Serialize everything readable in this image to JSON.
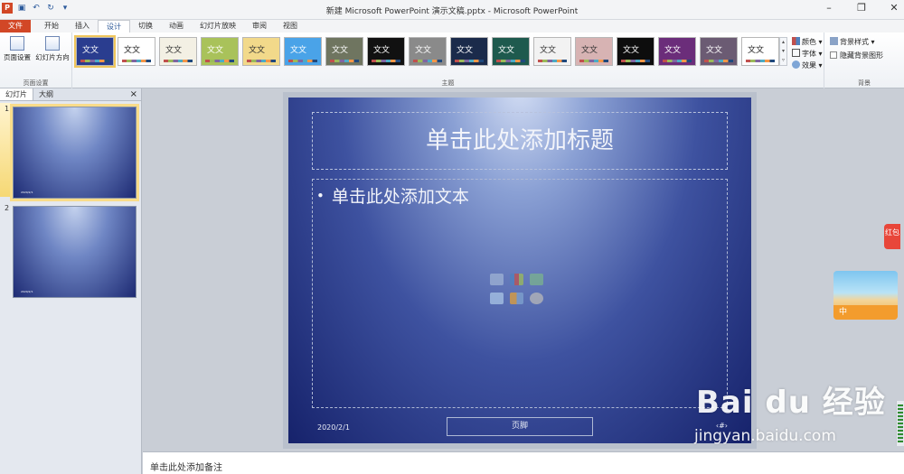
{
  "window": {
    "title": "新建 Microsoft PowerPoint 演示文稿.pptx - Microsoft PowerPoint",
    "app_logo": "P"
  },
  "ribbon_tabs": [
    "文件",
    "开始",
    "插入",
    "设计",
    "切换",
    "动画",
    "幻灯片放映",
    "审阅",
    "视图"
  ],
  "active_tab": "设计",
  "groups": {
    "page_setup": {
      "label": "页面设置",
      "btn_setup": "页面设置",
      "btn_orientation": "幻灯片方向"
    },
    "themes": {
      "label": "主题",
      "items": [
        {
          "text": "文文",
          "bg": "#2a3d8f",
          "fg": "#ffffff"
        },
        {
          "text": "文文",
          "bg": "#ffffff",
          "fg": "#222222"
        },
        {
          "text": "文文",
          "bg": "#f3f0e4",
          "fg": "#333333"
        },
        {
          "text": "文文",
          "bg": "#a9c25a",
          "fg": "#ffffff"
        },
        {
          "text": "文文",
          "bg": "#f2d98a",
          "fg": "#333333"
        },
        {
          "text": "文文",
          "bg": "#4aa3e8",
          "fg": "#ffffff"
        },
        {
          "text": "文文",
          "bg": "#6f7560",
          "fg": "#ffffff"
        },
        {
          "text": "文文",
          "bg": "#111111",
          "fg": "#ffffff"
        },
        {
          "text": "文文",
          "bg": "#8a8a8a",
          "fg": "#ffffff"
        },
        {
          "text": "文文",
          "bg": "#1b2b4b",
          "fg": "#ffffff"
        },
        {
          "text": "文文",
          "bg": "#1e5a4e",
          "fg": "#ffffff"
        },
        {
          "text": "文文",
          "bg": "#f2f2f2",
          "fg": "#333333"
        },
        {
          "text": "文文",
          "bg": "#d7b3b3",
          "fg": "#333333"
        },
        {
          "text": "文文",
          "bg": "#0d0d0d",
          "fg": "#ffffff"
        },
        {
          "text": "文文",
          "bg": "#6b2d7a",
          "fg": "#ffffff"
        },
        {
          "text": "文文",
          "bg": "#6b5b73",
          "fg": "#ffffff"
        },
        {
          "text": "文文",
          "bg": "#ffffff",
          "fg": "#222222"
        }
      ]
    },
    "theme_options": {
      "colors": "颜色",
      "fonts": "字体",
      "effects": "效果"
    },
    "background": {
      "label": "背景",
      "styles": "背景样式",
      "hide_graphics": "隐藏背景图形"
    }
  },
  "panel": {
    "tab_slides": "幻灯片",
    "tab_outline": "大纲",
    "close": "×",
    "slide_numbers": [
      "1",
      "2"
    ]
  },
  "slide": {
    "title_placeholder": "单击此处添加标题",
    "body_placeholder": "单击此处添加文本",
    "date": "2020/2/1",
    "footer": "页脚",
    "number": "‹#›"
  },
  "notes": {
    "placeholder": "单击此处添加备注"
  },
  "side": {
    "red_tag": "红包",
    "banner_text": "中"
  },
  "watermark": {
    "main": "Bai du 经验",
    "sub": "jingyan.baidu.com"
  }
}
